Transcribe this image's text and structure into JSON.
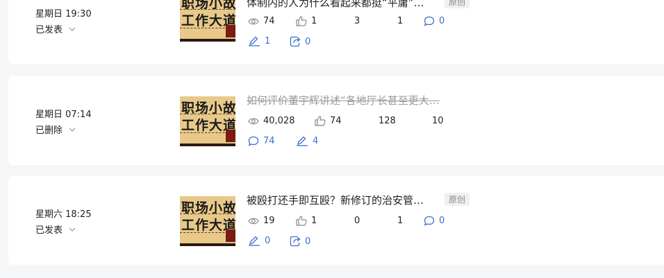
{
  "rows": [
    {
      "time": "星期日 19:30",
      "status": "已发表",
      "thumb_line1": "职场小故事",
      "thumb_line2": "工作大道理",
      "title": "体制内的人为什么看起来都挺“平庸”…",
      "badge": "原创",
      "views": "74",
      "likes": "1",
      "n1": "3",
      "n2": "1",
      "comments": "0",
      "edits": "1",
      "shares": "0"
    },
    {
      "time": "星期日 07:14",
      "status": "已删除",
      "thumb_line1": "职场小故事",
      "thumb_line2": "工作大道理",
      "title": "如何评价董宇辉讲述“各地厅长甚至更大…",
      "views": "40,028",
      "likes": "74",
      "n1": "128",
      "n2": "10",
      "comments": "74",
      "edits": "4"
    },
    {
      "time": "星期六 18:25",
      "status": "已发表",
      "thumb_line1": "职场小故事",
      "thumb_line2": "工作大道理",
      "title": "被殴打还手即互殴？新修订的治安管…",
      "badge": "原创",
      "views": "19",
      "likes": "1",
      "n1": "0",
      "n2": "1",
      "comments": "0",
      "edits": "0",
      "shares": "0"
    }
  ],
  "colors": {
    "link_blue": "#3b6fcc",
    "text": "#222222",
    "muted": "#999999"
  },
  "icons": [
    "chevron-down-icon",
    "eye-icon",
    "thumbs-up-icon",
    "comment-icon",
    "pencil-icon",
    "share-icon"
  ]
}
